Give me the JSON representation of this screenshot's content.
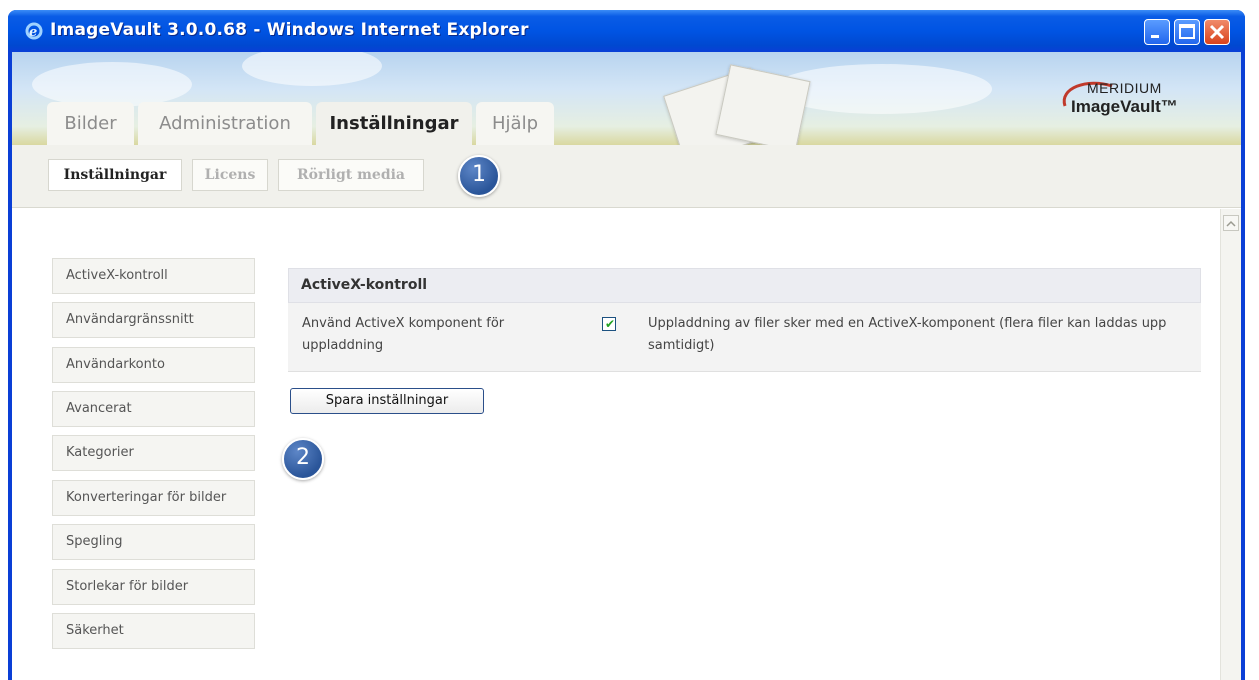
{
  "window": {
    "title": "ImageVault 3.0.0.68 - Windows Internet Explorer"
  },
  "logo": {
    "line1": "MERIDIUM",
    "line2": "ImageVault™"
  },
  "main_tabs": [
    {
      "label": "Bilder",
      "active": false
    },
    {
      "label": "Administration",
      "active": false
    },
    {
      "label": "Inställningar",
      "active": true
    },
    {
      "label": "Hjälp",
      "active": false
    }
  ],
  "sub_tabs": [
    {
      "label": "Inställningar",
      "active": true
    },
    {
      "label": "Licens",
      "active": false
    },
    {
      "label": "Rörligt media",
      "active": false
    }
  ],
  "callouts": [
    "1",
    "2"
  ],
  "side_menu": [
    "ActiveX-kontroll",
    "Användargränssnitt",
    "Användarkonto",
    "Avancerat",
    "Kategorier",
    "Konverteringar för bilder",
    "Spegling",
    "Storlekar för bilder",
    "Säkerhet"
  ],
  "panel": {
    "title": "ActiveX-kontroll",
    "setting_label": "Använd ActiveX komponent för uppladdning",
    "checked": true,
    "setting_description": "Uppladdning av filer sker med en ActiveX-komponent (flera filer kan laddas upp samtidigt)"
  },
  "save_button": "Spara inställningar",
  "colors": {
    "titlebar": "#0054e3",
    "badge": "#2a5599",
    "checkmark": "#21a121"
  }
}
